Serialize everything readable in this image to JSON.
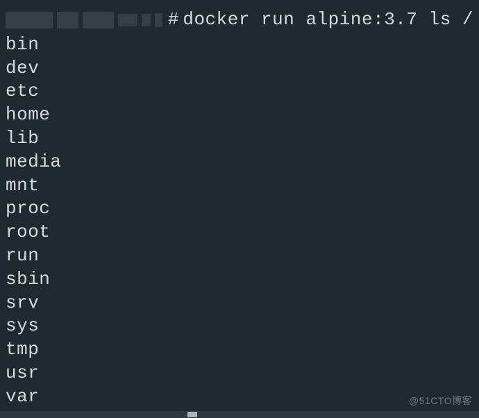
{
  "prompt_symbol": "#",
  "command": "docker run alpine:3.7 ls /",
  "output": [
    "bin",
    "dev",
    "etc",
    "home",
    "lib",
    "media",
    "mnt",
    "proc",
    "root",
    "run",
    "sbin",
    "srv",
    "sys",
    "tmp",
    "usr",
    "var"
  ],
  "watermark": "@51CTO博客"
}
